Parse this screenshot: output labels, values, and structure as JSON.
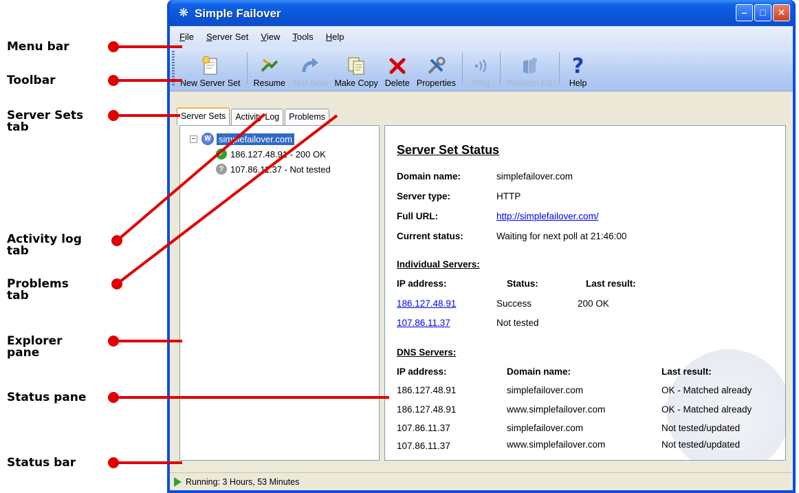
{
  "callouts": {
    "menu_bar": "Menu bar",
    "toolbar": "Toolbar",
    "server_sets_tab_l1": "Server Sets",
    "server_sets_tab_l2": "tab",
    "activity_log_tab_l1": "Activity log",
    "activity_log_tab_l2": "tab",
    "problems_tab_l1": "Problems",
    "problems_tab_l2": "tab",
    "explorer_pane_l1": "Explorer",
    "explorer_pane_l2": "pane",
    "status_pane": "Status pane",
    "status_bar": "Status bar"
  },
  "window": {
    "title": "Simple Failover"
  },
  "menu": [
    "File",
    "Server Set",
    "View",
    "Tools",
    "Help"
  ],
  "toolbar": {
    "new_server_set": "New Server Set",
    "resume": "Resume",
    "test_now": "Test Now",
    "make_copy": "Make Copy",
    "delete": "Delete",
    "properties": "Properties",
    "ping": "Ping",
    "problem_kb": "Problem KB",
    "help": "Help"
  },
  "tabs": [
    "Server Sets",
    "Activity Log",
    "Problems"
  ],
  "tree": {
    "root": "simplefailover.com",
    "children": [
      "186.127.48.91 - 200 OK",
      "107.86.11.37 - Not tested"
    ]
  },
  "status": {
    "heading": "Server Set Status",
    "domain_name_label": "Domain name:",
    "domain_name": "simplefailover.com",
    "server_type_label": "Server type:",
    "server_type": "HTTP",
    "full_url_label": "Full URL:",
    "full_url": "http://simplefailover.com/",
    "current_status_label": "Current status:",
    "current_status": "Waiting for next poll at 21:46:00",
    "individual_heading": "Individual Servers:",
    "individual_cols": [
      "IP address:",
      "Status:",
      "Last result:"
    ],
    "individual_rows": [
      [
        "186.127.48.91",
        "Success",
        "200 OK"
      ],
      [
        "107.86.11.37",
        "Not tested",
        ""
      ]
    ],
    "dns_heading": "DNS Servers:",
    "dns_cols": [
      "IP address:",
      "Domain name:",
      "Last result:"
    ],
    "dns_rows": [
      [
        "186.127.48.91",
        "simplefailover.com",
        "OK - Matched already"
      ],
      [
        "186.127.48.91",
        "www.simplefailover.com",
        "OK - Matched already"
      ],
      [
        "107.86.11.37",
        "simplefailover.com",
        "Not tested/updated"
      ],
      [
        "107.86.11.37",
        "www.simplefailover.com",
        "Not tested/updated"
      ]
    ]
  },
  "statusbar": {
    "text": "Running: 3 Hours, 53 Minutes"
  },
  "colors": {
    "callout_line": "#e00000",
    "window_frame": "#0a4ee0",
    "selection": "#316ac5"
  }
}
